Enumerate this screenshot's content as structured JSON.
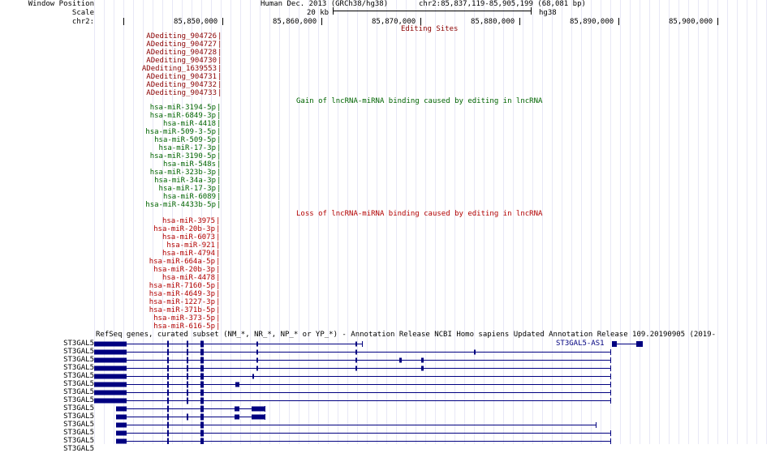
{
  "left_labels": {
    "window_position": "Window Position",
    "scale": "Scale",
    "chrom": "chr2:"
  },
  "header": {
    "assembly": "Human Dec. 2013 (GRCh38/hg38)",
    "position": "chr2:85,837,119-85,905,199 (68,081 bp)",
    "scale_text": "20 kb",
    "db": "hg38",
    "ticks": [
      "85,850,000",
      "85,860,000",
      "85,870,000",
      "85,880,000",
      "85,890,000",
      "85,900,000"
    ]
  },
  "editing_track": {
    "title": "Editing Sites",
    "items": [
      "ADediting_904726",
      "ADediting_904727",
      "ADediting_904728",
      "ADediting_904730",
      "ADediting_1639553",
      "ADediting_904731",
      "ADediting_904732",
      "ADediting_904733"
    ]
  },
  "gain_track": {
    "title": "Gain of lncRNA-miRNA binding caused by editing in lncRNA",
    "items": [
      "hsa-miR-3194-5p",
      "hsa-miR-6849-3p",
      "hsa-miR-4418",
      "hsa-miR-509-3-5p",
      "hsa-miR-509-5p",
      "hsa-miR-17-3p",
      "hsa-miR-3190-5p",
      "hsa-miR-548s",
      "hsa-miR-323b-3p",
      "hsa-miR-34a-3p",
      "hsa-miR-17-3p",
      "hsa-miR-6089",
      "hsa-miR-4433b-5p"
    ]
  },
  "loss_track": {
    "title": "Loss of lncRNA-miRNA binding caused by editing in lncRNA",
    "items": [
      "hsa-miR-3975",
      "hsa-miR-20b-3p",
      "hsa-miR-6073",
      "hsa-miR-921",
      "hsa-miR-4794",
      "hsa-miR-664a-5p",
      "hsa-miR-20b-3p",
      "hsa-miR-4478",
      "hsa-miR-7160-5p",
      "hsa-miR-4649-3p",
      "hsa-miR-1227-3p",
      "hsa-miR-371b-5p",
      "hsa-miR-373-5p",
      "hsa-miR-616-5p"
    ]
  },
  "genes_track": {
    "title": "RefSeq genes, curated subset (NM_*, NR_*, NP_* or YP_*) - Annotation Release NCBI Homo sapiens Updated Annotation Release 109.20190905 (2019-",
    "gene_labels": [
      "ST3GAL5",
      "ST3GAL5",
      "ST3GAL5",
      "ST3GAL5",
      "ST3GAL5",
      "ST3GAL5",
      "ST3GAL5",
      "ST3GAL5",
      "ST3GAL5",
      "ST3GAL5",
      "ST3GAL5",
      "ST3GAL5",
      "ST3GAL5",
      "ST3GAL5"
    ],
    "as1_label": "ST3GAL5-AS1"
  },
  "colors": {
    "editing": "#8b0000",
    "gain": "#006400",
    "loss": "#b20000",
    "gene": "#000080",
    "grid": "#e8e8f6"
  }
}
